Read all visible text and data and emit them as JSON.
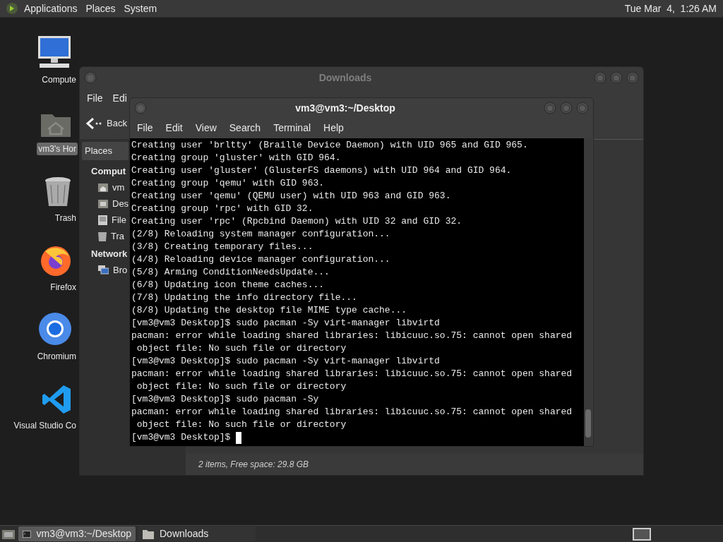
{
  "top_panel": {
    "menus": [
      "Applications",
      "Places",
      "System"
    ],
    "clock": "Tue Mar  4,  1:26 AM"
  },
  "desktop_icons": [
    {
      "kind": "computer",
      "label": "Compute",
      "selected": false
    },
    {
      "kind": "home",
      "label": "vm3's Hor",
      "selected": true
    },
    {
      "kind": "trash",
      "label": "Trash",
      "selected": false
    },
    {
      "kind": "firefox",
      "label": "Firefox",
      "selected": false
    },
    {
      "kind": "chromium",
      "label": "Chromium",
      "selected": false
    },
    {
      "kind": "vscode",
      "label": "Visual Studio Co",
      "selected": false
    }
  ],
  "file_manager": {
    "title": "Downloads",
    "menu": [
      "File",
      "Edi"
    ],
    "back": "Back",
    "sidebar": {
      "dropdown": "Places",
      "sections": [
        {
          "heading": "Comput",
          "items": [
            {
              "kind": "home",
              "label": "vm"
            },
            {
              "kind": "desktop",
              "label": "Des"
            },
            {
              "kind": "disk",
              "label": "File"
            },
            {
              "kind": "trash",
              "label": "Tra"
            }
          ]
        },
        {
          "heading": "Network",
          "items": [
            {
              "kind": "network",
              "label": "Bro"
            }
          ]
        }
      ]
    },
    "status": "2 items, Free space: 29.8 GB"
  },
  "terminal": {
    "title": "vm3@vm3:~/Desktop",
    "menu": [
      "File",
      "Edit",
      "View",
      "Search",
      "Terminal",
      "Help"
    ],
    "lines": [
      "Creating user 'brltty' (Braille Device Daemon) with UID 965 and GID 965.",
      "Creating group 'gluster' with GID 964.",
      "Creating user 'gluster' (GlusterFS daemons) with UID 964 and GID 964.",
      "Creating group 'qemu' with GID 963.",
      "Creating user 'qemu' (QEMU user) with UID 963 and GID 963.",
      "Creating group 'rpc' with GID 32.",
      "Creating user 'rpc' (Rpcbind Daemon) with UID 32 and GID 32.",
      "(2/8) Reloading system manager configuration...",
      "(3/8) Creating temporary files...",
      "(4/8) Reloading device manager configuration...",
      "(5/8) Arming ConditionNeedsUpdate...",
      "(6/8) Updating icon theme caches...",
      "(7/8) Updating the info directory file...",
      "(8/8) Updating the desktop file MIME type cache...",
      "[vm3@vm3 Desktop]$ sudo pacman -Sy virt-manager libvirtd",
      "pacman: error while loading shared libraries: libicuuc.so.75: cannot open shared",
      " object file: No such file or directory",
      "[vm3@vm3 Desktop]$ sudo pacman -Sy virt-manager libvirtd",
      "pacman: error while loading shared libraries: libicuuc.so.75: cannot open shared",
      " object file: No such file or directory",
      "[vm3@vm3 Desktop]$ sudo pacman -Sy",
      "pacman: error while loading shared libraries: libicuuc.so.75: cannot open shared",
      " object file: No such file or directory"
    ],
    "prompt": "[vm3@vm3 Desktop]$"
  },
  "taskbar": {
    "items": [
      {
        "kind": "terminal",
        "label": "vm3@vm3:~/Desktop",
        "selected": true
      },
      {
        "kind": "folder",
        "label": "Downloads",
        "selected": false
      }
    ]
  }
}
